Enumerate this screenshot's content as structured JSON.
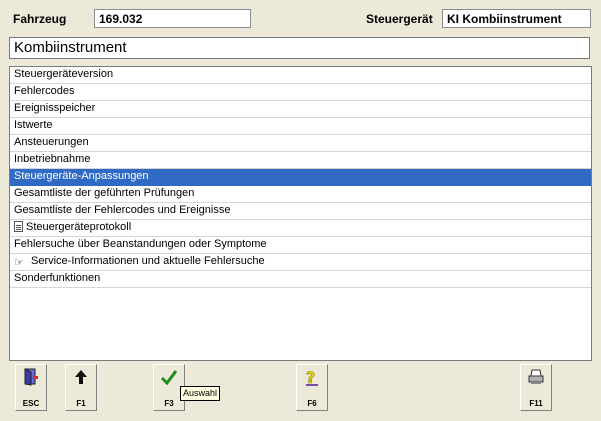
{
  "header": {
    "fahrzeug_label": "Fahrzeug",
    "fahrzeug_value": "169.032",
    "steuergeraet_label": "Steuergerät",
    "steuergeraet_value": "KI Kombiinstrument"
  },
  "title": "Kombiinstrument",
  "menu": {
    "items": [
      {
        "label": "Steuergeräteversion"
      },
      {
        "label": "Fehlercodes"
      },
      {
        "label": "Ereignisspeicher"
      },
      {
        "label": "Istwerte"
      },
      {
        "label": "Ansteuerungen"
      },
      {
        "label": "Inbetriebnahme"
      },
      {
        "label": "Steuergeräte-Anpassungen",
        "selected": true
      },
      {
        "label": "Gesamtliste der geführten Prüfungen"
      },
      {
        "label": "Gesamtliste der Fehlercodes und Ereignisse"
      },
      {
        "label": "Steuergeräteprotokoll",
        "icon": "document-icon"
      },
      {
        "label": "Fehlersuche über Beanstandungen oder Symptome"
      },
      {
        "label": "Service-Informationen und aktuelle Fehlersuche",
        "icon": "pointing-hand-icon"
      },
      {
        "label": "Sonderfunktionen"
      }
    ]
  },
  "buttons": {
    "esc": {
      "label": "ESC",
      "icon": "exit-door-icon"
    },
    "f1": {
      "label": "F1",
      "icon": "up-arrow-icon"
    },
    "f3": {
      "label": "F3",
      "icon": "checkmark-icon"
    },
    "f6": {
      "label": "F6",
      "icon": "help-question-icon"
    },
    "f11": {
      "label": "F11",
      "icon": "printer-icon"
    }
  },
  "tooltip": "Auswahl",
  "colors": {
    "selection": "#316ac5",
    "background": "#ece9d8",
    "tooltip_bg": "#ffffe1"
  }
}
